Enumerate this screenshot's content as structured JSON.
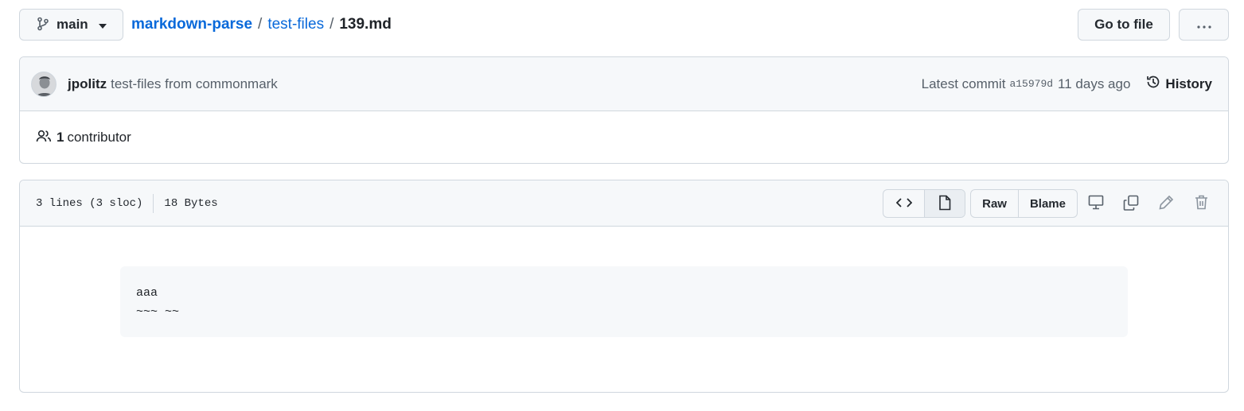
{
  "branch": {
    "name": "main"
  },
  "breadcrumb": {
    "repo": "markdown-parse",
    "separator": "/",
    "folder": "test-files",
    "file": "139.md"
  },
  "toolbar": {
    "goto_label": "Go to file"
  },
  "commit": {
    "author": "jpolitz",
    "message": "test-files from commonmark",
    "latest_label": "Latest commit",
    "sha": "a15979d",
    "time": "11 days ago",
    "history_label": "History"
  },
  "contributors": {
    "count": "1",
    "label": "contributor"
  },
  "file": {
    "lines_info": "3 lines (3 sloc)",
    "size": "18 Bytes",
    "raw_label": "Raw",
    "blame_label": "Blame",
    "content_lines": [
      "aaa",
      "~~~ ~~"
    ]
  },
  "colors": {
    "link": "#0969da",
    "border": "#d0d7de",
    "header_bg": "#f6f8fa",
    "muted": "#57606a"
  },
  "icons": [
    "git-branch-icon",
    "caret-down-icon",
    "kebab-horizontal-icon",
    "history-icon",
    "people-icon",
    "code-icon",
    "file-icon",
    "desktop-icon",
    "copy-icon",
    "pencil-icon",
    "trash-icon"
  ]
}
